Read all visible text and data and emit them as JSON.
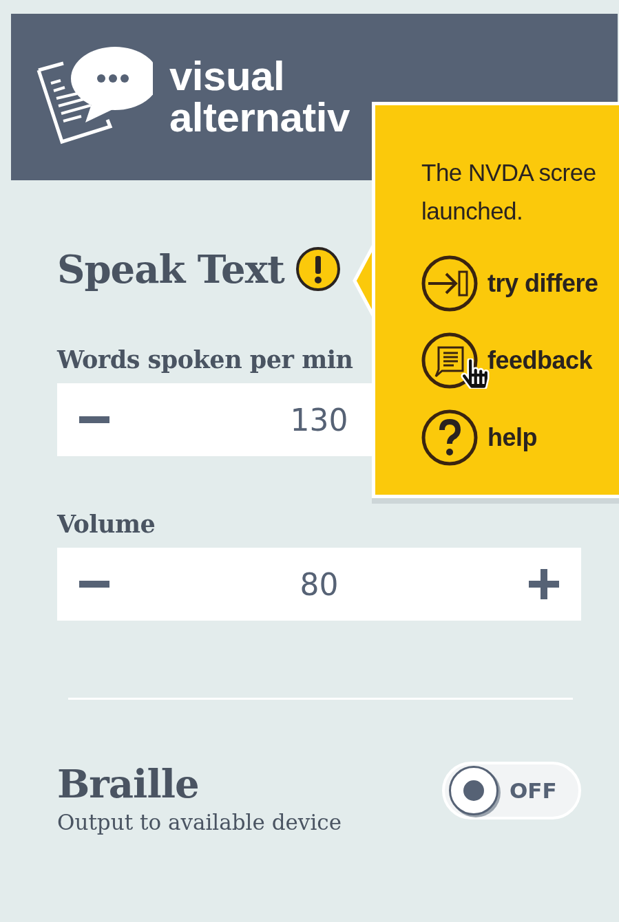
{
  "header": {
    "title_lines": [
      "visual",
      "alternativ"
    ]
  },
  "speak_text": {
    "title": "Speak Text",
    "warning": true,
    "steppers": [
      {
        "label": "Words spoken per min",
        "value": "130",
        "show_plus": false
      },
      {
        "label": "Volume",
        "value": "80",
        "show_plus": true
      }
    ]
  },
  "braille": {
    "title": "Braille",
    "subtitle": "Output to available device",
    "on": false,
    "toggle_label": "OFF"
  },
  "popup": {
    "message_lines": [
      "The NVDA scree",
      "launched."
    ],
    "actions": [
      {
        "kind": "switch",
        "label": "try differe"
      },
      {
        "kind": "feedback",
        "label": "feedback",
        "hovered": true
      },
      {
        "kind": "help",
        "label": "help"
      }
    ]
  }
}
